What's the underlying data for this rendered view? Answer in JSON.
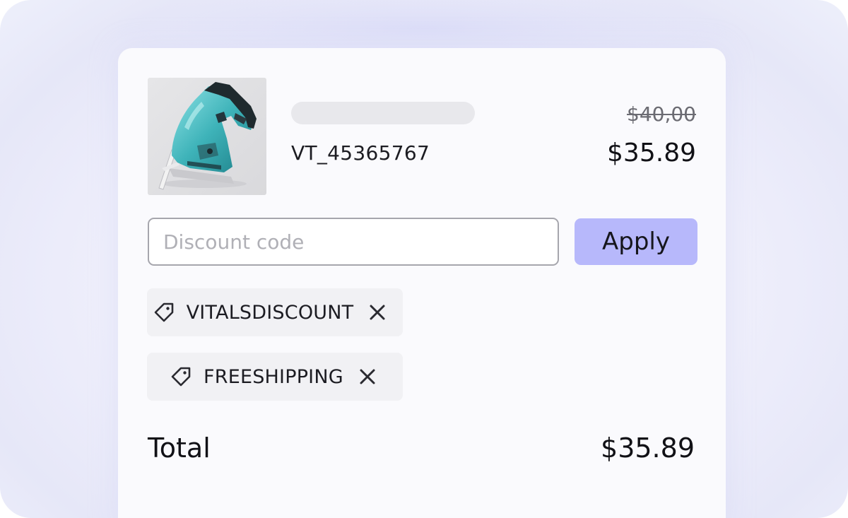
{
  "product": {
    "image_alt": "jigsaw-product-image",
    "sku": "VT_45365767",
    "original_price": "$40,00",
    "price": "$35.89"
  },
  "discount": {
    "placeholder": "Discount code",
    "value": "",
    "apply_label": "Apply"
  },
  "applied_codes": [
    {
      "code": "VITALSDISCOUNT",
      "icon": "tag-icon",
      "remove_icon": "close-icon"
    },
    {
      "code": "FREESHIPPING",
      "icon": "tag-icon",
      "remove_icon": "close-icon"
    }
  ],
  "summary": {
    "total_label": "Total",
    "total_value": "$35.89"
  },
  "colors": {
    "apply_button": "#b7b8fb",
    "chip_background": "#f1f1f4",
    "card_background": "#fafafd"
  }
}
